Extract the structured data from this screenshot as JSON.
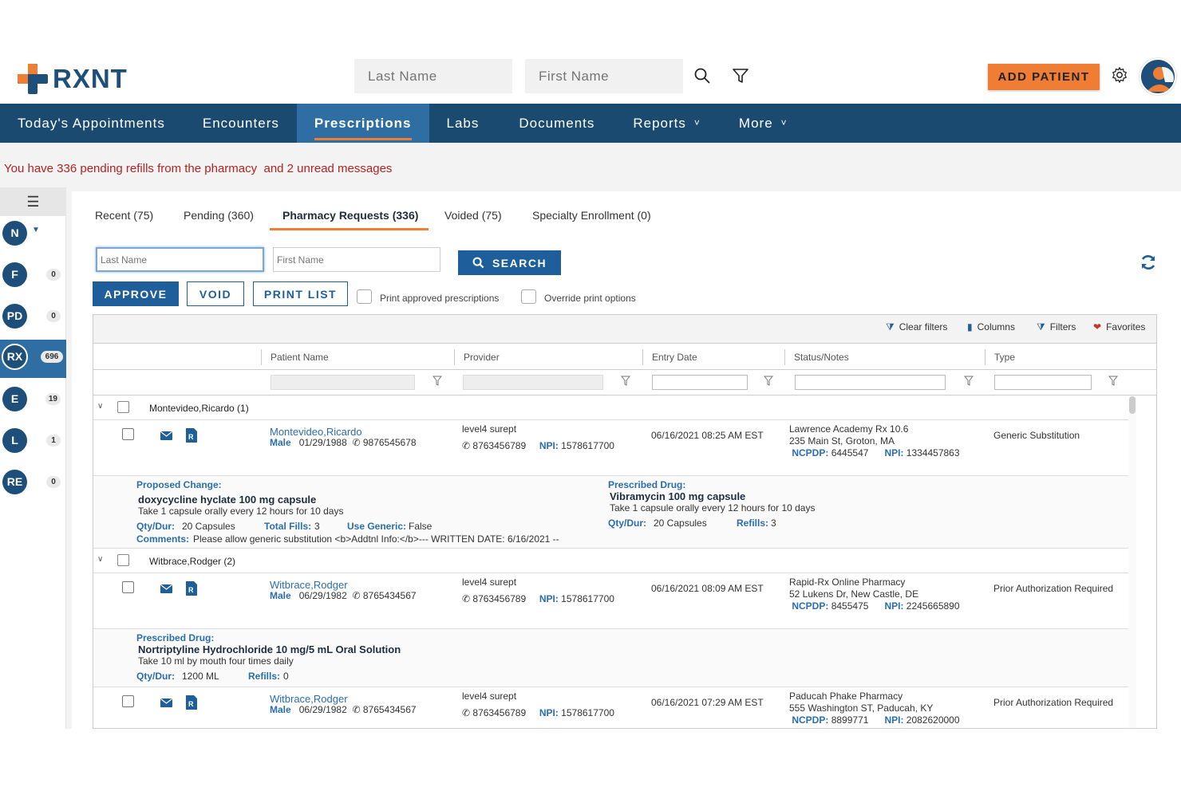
{
  "header": {
    "logo_text": "RXNT",
    "search_last_placeholder": "Last Name",
    "search_first_placeholder": "First Name",
    "add_patient_label": "ADD PATIENT",
    "brand_color": "#1b4a70",
    "accent_color": "#ef7d33"
  },
  "nav": {
    "items": [
      {
        "label": "Today's Appointments"
      },
      {
        "label": "Encounters"
      },
      {
        "label": "Prescriptions",
        "active": true
      },
      {
        "label": "Labs"
      },
      {
        "label": "Documents"
      },
      {
        "label": "Reports",
        "dropdown": true
      },
      {
        "label": "More",
        "dropdown": true
      }
    ]
  },
  "banner": "You have 336 pending refills from the pharmacy  and 2 unread messages",
  "sidebar": {
    "items": [
      {
        "label": "N",
        "count": ""
      },
      {
        "label": "F",
        "count": "0"
      },
      {
        "label": "PD",
        "count": "0"
      },
      {
        "label": "RX",
        "count": "696"
      },
      {
        "label": "E",
        "count": "19"
      },
      {
        "label": "L",
        "count": "1"
      },
      {
        "label": "RE",
        "count": "0"
      }
    ]
  },
  "tabs": [
    {
      "label": "Recent (75)"
    },
    {
      "label": "Pending (360)"
    },
    {
      "label": "Pharmacy Requests (336)"
    },
    {
      "label": "Voided (75)"
    },
    {
      "label": "Specialty Enrollment (0)"
    }
  ],
  "filters": {
    "last_placeholder": "Last Name",
    "first_placeholder": "First Name",
    "search_label": "SEARCH"
  },
  "actions": {
    "approve": "APPROVE",
    "void": "VOID",
    "print_list": "PRINT LIST",
    "print_approved": "Print approved prescriptions",
    "override_print": "Override print options"
  },
  "toolbar": {
    "clear_filters": "Clear filters",
    "columns": "Columns",
    "filters": "Filters",
    "favorites": "Favorites"
  },
  "columns": [
    "Patient Name",
    "Provider",
    "Entry Date",
    "Status/Notes",
    "Type"
  ],
  "groups": [
    {
      "label": "Montevideo,Ricardo (1)",
      "rows": [
        {
          "name": "Montevideo,Ricardo",
          "gender": "Male",
          "dob": "01/29/1988",
          "phone": "9876545678",
          "provider": "level4 surept",
          "provider_phone": "8763456789",
          "provider_npi": "1578617700",
          "entry_date": "06/16/2021 08:25 AM EST",
          "pharmacy": "Lawrence Academy Rx 10.6",
          "pharmacy_addr": "235 Main St, Groton, MA",
          "ncpdp": "6445547",
          "pharm_npi": "1334457863",
          "type": "Generic Substitution",
          "detail": {
            "proposed_label": "Proposed Change:",
            "proposed_drug": "doxycycline hyclate 100 mg capsule",
            "proposed_sig": "Take 1 capsule orally every 12 hours for 10 days",
            "qty": "20 Capsules",
            "total_fills": "3",
            "use_generic": "False",
            "comments": "Please allow generic substitution <b>Addtnl Info:</b>--- WRITTEN DATE: 6/16/2021 --",
            "prescribed_label": "Prescribed Drug:",
            "prescribed_drug": "Vibramycin 100 mg capsule",
            "prescribed_sig": "Take 1 capsule orally every 12 hours for 10 days",
            "prescribed_qty": "20 Capsules",
            "refills": "3"
          }
        }
      ]
    },
    {
      "label": "Witbrace,Rodger (2)",
      "rows": [
        {
          "name": "Witbrace,Rodger",
          "gender": "Male",
          "dob": "06/29/1982",
          "phone": "8765434567",
          "provider": "level4 surept",
          "provider_phone": "8763456789",
          "provider_npi": "1578617700",
          "entry_date": "06/16/2021 08:09 AM EST",
          "pharmacy": "Rapid-Rx Online Pharmacy",
          "pharmacy_addr": "52 Lukens Dr, New Castle, DE",
          "ncpdp": "8455475",
          "pharm_npi": "2245665890",
          "type": "Prior Authorization Required",
          "detail": {
            "prescribed_label": "Prescribed Drug:",
            "prescribed_drug": "Nortriptyline Hydrochloride 10 mg/5 mL Oral Solution",
            "prescribed_sig": "Take 10 ml by mouth four times daily",
            "prescribed_qty": "1200 ML",
            "refills": "0"
          }
        },
        {
          "name": "Witbrace,Rodger",
          "gender": "Male",
          "dob": "06/29/1982",
          "phone": "8765434567",
          "provider": "level4 surept",
          "provider_phone": "8763456789",
          "provider_npi": "1578617700",
          "entry_date": "06/16/2021 07:29 AM EST",
          "pharmacy": "Paducah Phake Pharmacy",
          "pharmacy_addr": "555 Washington ST, Paducah, KY",
          "ncpdp": "8899771",
          "pharm_npi": "2082620000",
          "type": "Prior Authorization Required"
        }
      ]
    }
  ],
  "labels": {
    "qty_dur": "Qty/Dur:",
    "total_fills": "Total Fills:",
    "use_generic": "Use Generic:",
    "comments": "Comments:",
    "refills": "Refills:",
    "npi": "NPI:",
    "ncpdp": "NCPDP:"
  }
}
